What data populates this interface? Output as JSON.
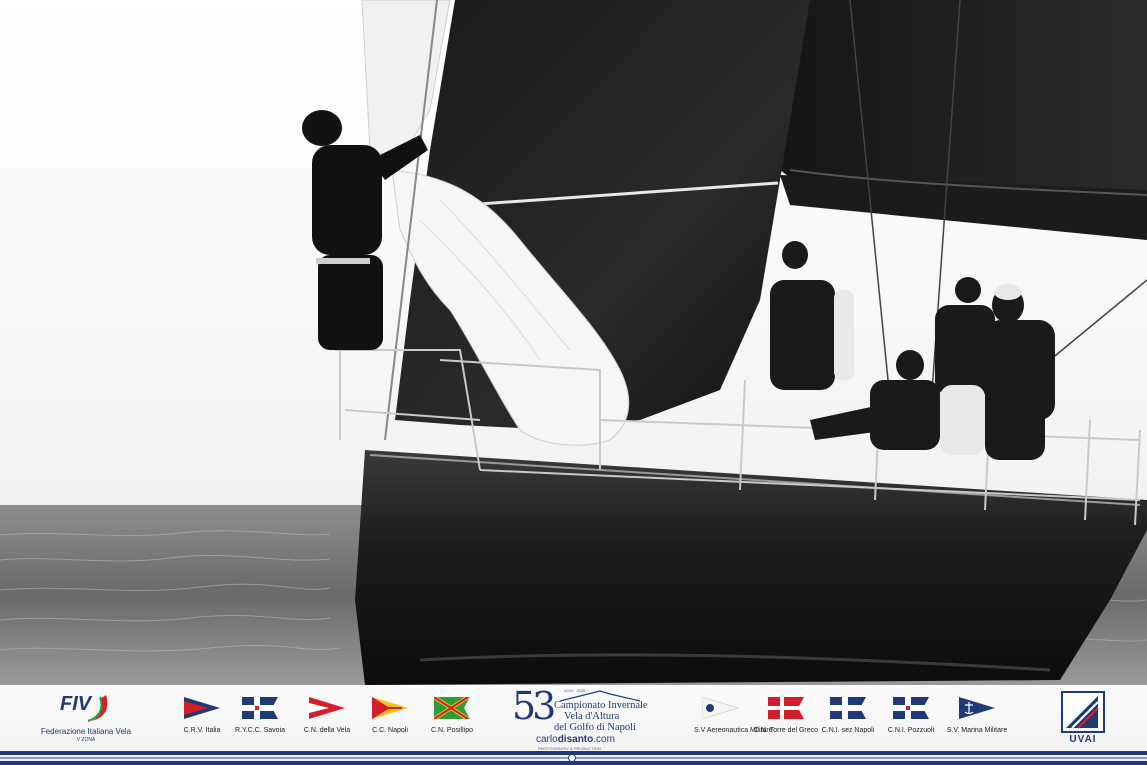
{
  "photo": {
    "subject": "photo"
  },
  "footer": {
    "fiv": {
      "mark": "FIV",
      "caption": "Federazione Italiana Vela",
      "sub": "V ZONA"
    },
    "clubs_left": [
      {
        "label": "C.R.V. Italia",
        "flag": "crv-italia-flag-icon"
      },
      {
        "label": "R.Y.C.C. Savoia",
        "flag": "rycc-savoia-flag-icon"
      },
      {
        "label": "C.N. della Vela",
        "flag": "cn-della-vela-flag-icon"
      },
      {
        "label": "C.C. Napoli",
        "flag": "cc-napoli-flag-icon"
      },
      {
        "label": "C.N. Posillipo",
        "flag": "cn-posillipo-flag-icon"
      }
    ],
    "event": {
      "number": "53",
      "years": "2024 · 2025",
      "line1": "Campionato Invernale",
      "line2": "Vela d'Altura",
      "line3": "del Golfo di Napoli",
      "brand_a": "carlo",
      "brand_b": "disanto",
      "brand_c": ".com",
      "brand_sub": "PHOTOGRAPHY & PRODUCTION"
    },
    "clubs_right": [
      {
        "label": "S.V Aereonautica Militare",
        "flag": "sv-aeronautica-flag-icon"
      },
      {
        "label": "C.N. Torre del Greco",
        "flag": "cn-torre-del-greco-flag-icon"
      },
      {
        "label": "C.N.I. sez Napoli",
        "flag": "cni-napoli-flag-icon"
      },
      {
        "label": "C.N.I. Pozzuoli",
        "flag": "cni-pozzuoli-flag-icon"
      },
      {
        "label": "S.V. Marina Militare",
        "flag": "sv-marina-militare-flag-icon"
      }
    ],
    "uvai": {
      "label": "UVAI"
    }
  },
  "colors": {
    "navy": "#1f3a78",
    "red": "#d21f2a",
    "yellow": "#f2c21b",
    "green": "#2f9a3b"
  }
}
